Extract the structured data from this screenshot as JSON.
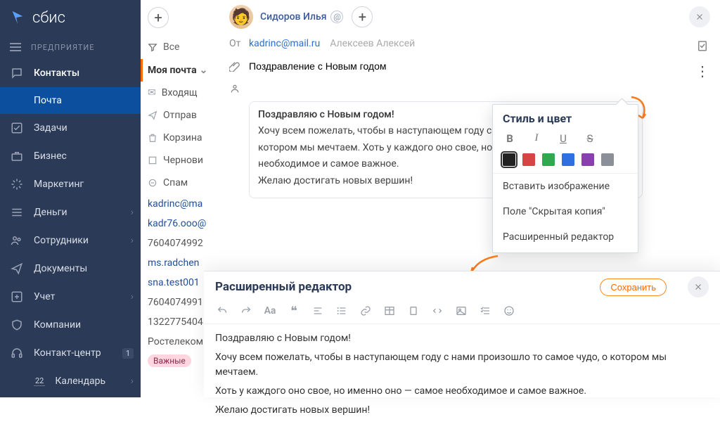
{
  "brand": "сбис",
  "section": "ПРЕДПРИЯТИЕ",
  "sidebar": {
    "items": [
      {
        "label": "Контакты"
      },
      {
        "label": "Почта"
      },
      {
        "label": "Задачи"
      },
      {
        "label": "Бизнес"
      },
      {
        "label": "Маркетинг"
      },
      {
        "label": "Деньги"
      },
      {
        "label": "Сотрудники"
      },
      {
        "label": "Документы"
      },
      {
        "label": "Учет"
      },
      {
        "label": "Компании"
      },
      {
        "label": "Контакт-центр",
        "badge": "1"
      },
      {
        "label": "Календарь",
        "badge": "22"
      }
    ]
  },
  "maillist": {
    "filter_all": "Все",
    "my_mail": "Моя почта",
    "folders": [
      "Входящ",
      "Отправ",
      "Корзина",
      "Чернови",
      "Спам"
    ],
    "senders": [
      "kadrinc@ma",
      "kadr76.ooo@",
      "7604074992",
      "ms.radchen",
      "sna.test001",
      "7604074991",
      "1322775404",
      "Ростелеком"
    ],
    "tag": "Важные"
  },
  "compose": {
    "user": "Сидоров Илья",
    "from_label": "От",
    "from_email": "kadrinc@mail.ru",
    "from_hint": "Алексеев Алексей",
    "subject": "Поздравление с Новым годом",
    "greeting": "Поздравляю с Новым годом!",
    "p1": "Хочу всем пожелать, чтобы в наступающем году с нами п",
    "p2": "котором мы мечтаем. Хоть у каждого оно свое, но именн",
    "p3": "необходимое и самое важное.",
    "p4": "Желаю достигать новых вершин!"
  },
  "popover": {
    "title": "Стиль и цвет",
    "colors": [
      "#222222",
      "#d64545",
      "#2fa84f",
      "#2f6fe0",
      "#8a3fae",
      "#8a8f98"
    ],
    "items": [
      "Вставить изображение",
      "Поле \"Скрытая копия\"",
      "Расширенный редактор"
    ]
  },
  "adv": {
    "title": "Расширенный редактор",
    "save": "Сохранить",
    "greeting": "Поздравляю с Новым годом!",
    "p1": "Хочу всем пожелать, чтобы в наступающем году с нами произошло то самое чудо, о котором мы мечтаем.",
    "p2": "Хоть у каждого оно свое, но именно оно — самое необходимое и самое важное.",
    "p3": "Желаю достигать новых вершин!"
  }
}
